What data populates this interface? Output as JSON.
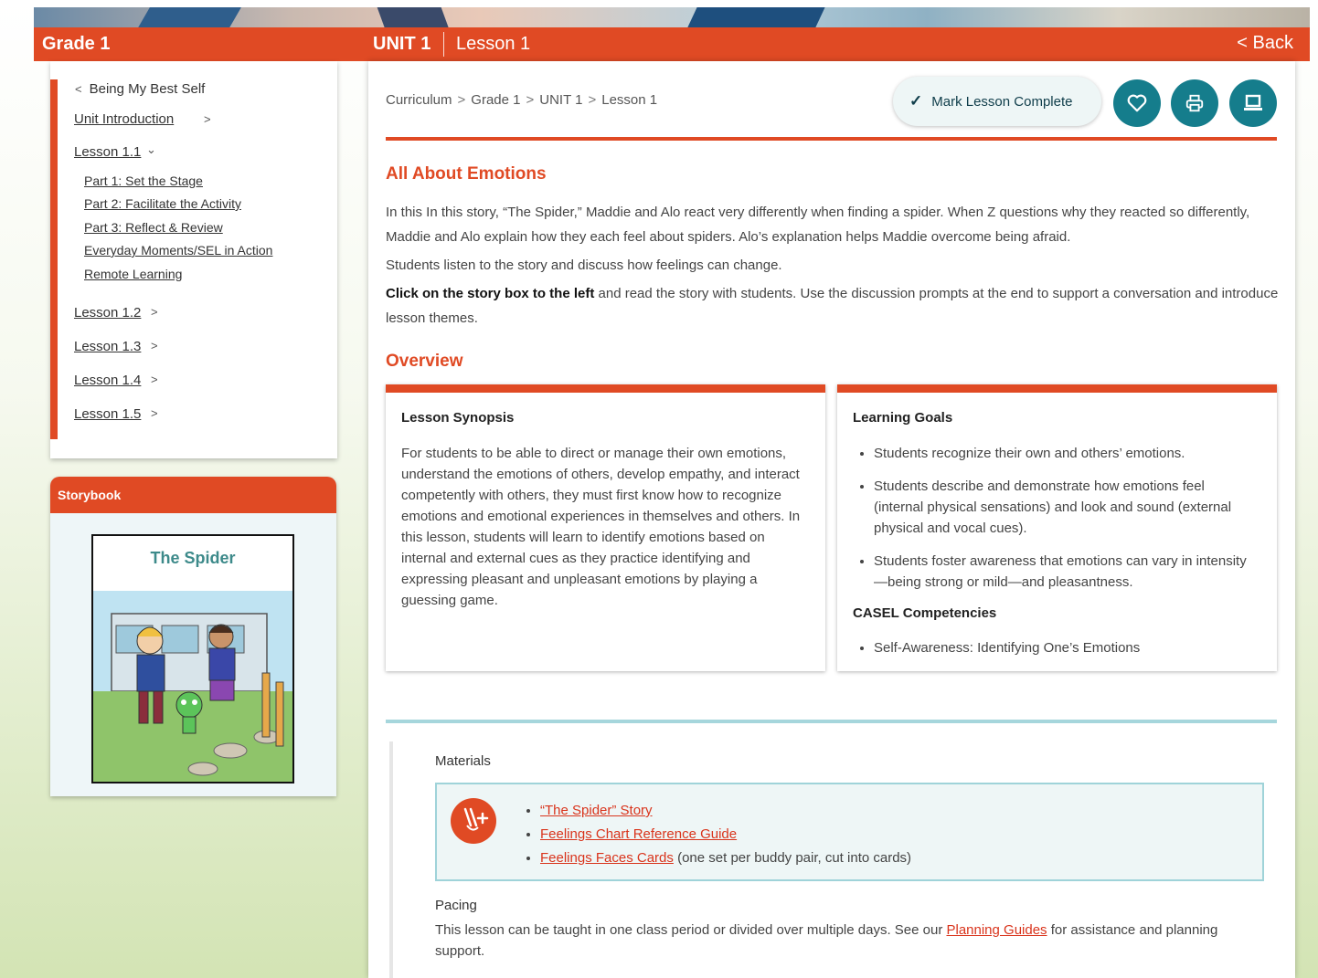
{
  "header": {
    "grade": "Grade 1",
    "unit": "UNIT 1",
    "lesson": "Lesson 1",
    "back": "< Back"
  },
  "sidebar": {
    "unit_title": "Being My Best Self",
    "unit_intro": "Unit Introduction",
    "lessons": [
      "Lesson 1.1",
      "Lesson 1.2",
      "Lesson 1.3",
      "Lesson 1.4",
      "Lesson 1.5"
    ],
    "parts": [
      "Part 1: Set the Stage",
      "Part 2: Facilitate the Activity",
      "Part 3: Reflect & Review",
      "Everyday Moments/SEL in Action",
      "Remote Learning"
    ]
  },
  "storybook": {
    "header": "Storybook",
    "book_title": "The Spider"
  },
  "breadcrumb": [
    "Curriculum",
    "Grade 1",
    "UNIT 1",
    "Lesson 1"
  ],
  "actions": {
    "mark_complete": "Mark Lesson Complete"
  },
  "content": {
    "title": "All About Emotions",
    "intro1": "In this In this story, “The Spider,” Maddie and Alo react very differently when finding a spider. When Z questions why they reacted so differently, Maddie and Alo explain how they each feel about spiders. Alo’s explanation helps Maddie overcome being afraid.",
    "intro2": "Students listen to the story and discuss how feelings can change.",
    "intro3_bold": "Click on the story box to the left",
    "intro3_rest": " and read the story with students. Use the discussion prompts at the end to support a conversation and introduce lesson themes.",
    "overview": "Overview"
  },
  "synopsis": {
    "title": "Lesson Synopsis",
    "text": "For students to be able to direct or manage their own emotions, understand the emotions of others, develop empathy, and interact competently with others, they must first know how to recognize emotions and emotional experiences in themselves and others. In this lesson, students will learn to identify emotions based on internal and external cues as they practice identifying and expressing pleasant and unpleasant emotions by playing a guessing game."
  },
  "goals": {
    "title": "Learning Goals",
    "items": [
      "Students recognize their own and others’ emotions.",
      "Students describe and demonstrate how emotions feel (internal physical sensations) and look and sound (external physical and vocal cues).",
      "Students foster awareness that emotions can vary in intensity—being strong or mild—and pleasantness."
    ],
    "casel_title": "CASEL Competencies",
    "casel_items": [
      "Self-Awareness: Identifying One’s Emotions"
    ]
  },
  "materials": {
    "label": "Materials",
    "items": [
      "“The Spider” Story",
      "Feelings Chart Reference Guide",
      "Feelings Faces Cards"
    ],
    "cards_note": " (one set per buddy pair, cut into cards)"
  },
  "pacing": {
    "label": "Pacing",
    "text_before": "This lesson can be taught in one class period or divided over multiple days. See our ",
    "link": "Planning Guides",
    "text_after": " for assistance and planning support."
  },
  "colors": {
    "brand_orange": "#e04a24",
    "teal": "#157d8c",
    "light_teal": "#a6d6dc"
  }
}
